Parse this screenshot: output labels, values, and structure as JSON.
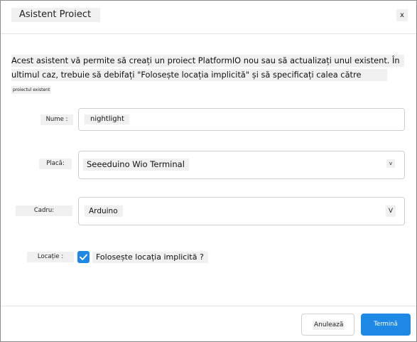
{
  "dialog": {
    "title": "Asistent Proiect",
    "close_label": "x"
  },
  "description": {
    "line1": "Acest asistent vă permite să creați un proiect PlatformIO nou sau să actualizați unul existent. În",
    "line2": "ultimul caz, trebuie să debifați \"Folosește locația implicită\" și să specificați calea către",
    "line3": "proiectul existent"
  },
  "form": {
    "name": {
      "label": "Nume :",
      "value": "nightlight"
    },
    "board": {
      "label": "Placă:",
      "value": "Seeeduino Wio Terminal",
      "chevron": "v"
    },
    "framework": {
      "label": "Cadru:",
      "value": "Arduino",
      "chevron": "V"
    },
    "location": {
      "label": "Locație :",
      "checkbox_label": "Folosește locația implicită ?",
      "checked": true
    }
  },
  "buttons": {
    "cancel": "Anulează",
    "finish": "Termină"
  },
  "colors": {
    "accent": "#1e88e5",
    "label_bg": "#f0f0f0",
    "border": "#cfcfcf"
  }
}
